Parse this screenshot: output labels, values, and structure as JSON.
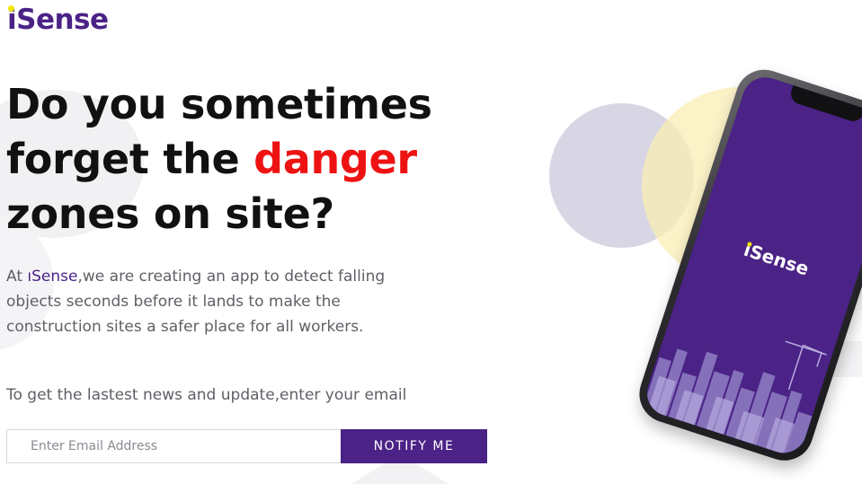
{
  "logo": {
    "dot_letter": "i",
    "rest": "Sense"
  },
  "headline": {
    "line1": "Do you sometimes",
    "line2_before": "forget the ",
    "line2_accent": "danger",
    "line3": "zones on site?"
  },
  "intro": {
    "prefix": "At ",
    "brand_dot": "ı",
    "brand_rest": "Sense",
    "rest": ",we are creating an app to detect falling objects seconds before it lands to make the construction sites a safer place for all workers."
  },
  "notify_prompt": "To get the lastest news and update,enter your email",
  "form": {
    "email_placeholder": "Enter Email Address",
    "email_value": "",
    "button_label": "NOTIFY ME"
  },
  "phone": {
    "logo_dot_letter": "i",
    "logo_rest": "Sense"
  },
  "colors": {
    "brand_purple": "#4b2286",
    "accent_red": "#ee1313",
    "dot_yellow": "#f2e600",
    "circle_purple": "#bebad2",
    "circle_yellow": "#faeeb4"
  },
  "icons": {
    "phone_illustration": "phone-mockup-illustration",
    "skyline": "city-skyline-crane-illustration"
  }
}
